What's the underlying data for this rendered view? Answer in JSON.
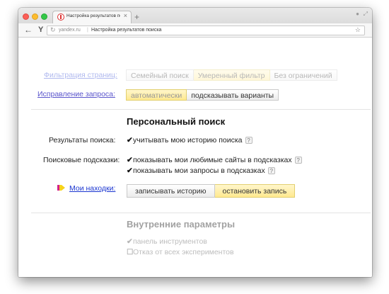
{
  "browser": {
    "tab_title": "Настройка результатов поис",
    "tab_close": "×",
    "new_tab": "+",
    "back": "←",
    "logo": "Y",
    "url_host": "yandex.ru",
    "url_sep": "|",
    "url_title": "Настройка результатов поиска",
    "star": "☆"
  },
  "filters": {
    "label": "Фильтрация страниц:",
    "options": [
      "Семейный поиск",
      "Умеренный фильтр",
      "Без ограничений"
    ],
    "selected": "Умеренный фильтр"
  },
  "correction": {
    "label": "Исправление запроса:",
    "options": [
      "автоматически",
      "подсказывать варианты"
    ],
    "selected": "автоматически"
  },
  "personal": {
    "title": "Персональный поиск",
    "results_label": "Результаты поиска:",
    "results_option": "учитывать мою историю поиска",
    "suggest_label": "Поисковые подсказки:",
    "suggest_option_1": "показывать мои любимые сайты в подсказках",
    "suggest_option_2": "показывать мои запросы в подсказках",
    "finds_label": "Мои находки:",
    "finds_buttons": [
      "записывать историю",
      "остановить запись"
    ],
    "finds_selected": "остановить запись",
    "help": "?",
    "check": "✔"
  },
  "internal": {
    "title": "Внутренние параметры",
    "option_1": "панель инструментов",
    "option_2": "Отказ от всех экспериментов"
  },
  "colors": {
    "link": "#1a35d0",
    "selected_fill": "#ffe98f",
    "arrow_yellow": "#f7d21b",
    "arrow_magenta": "#d21f8c"
  }
}
